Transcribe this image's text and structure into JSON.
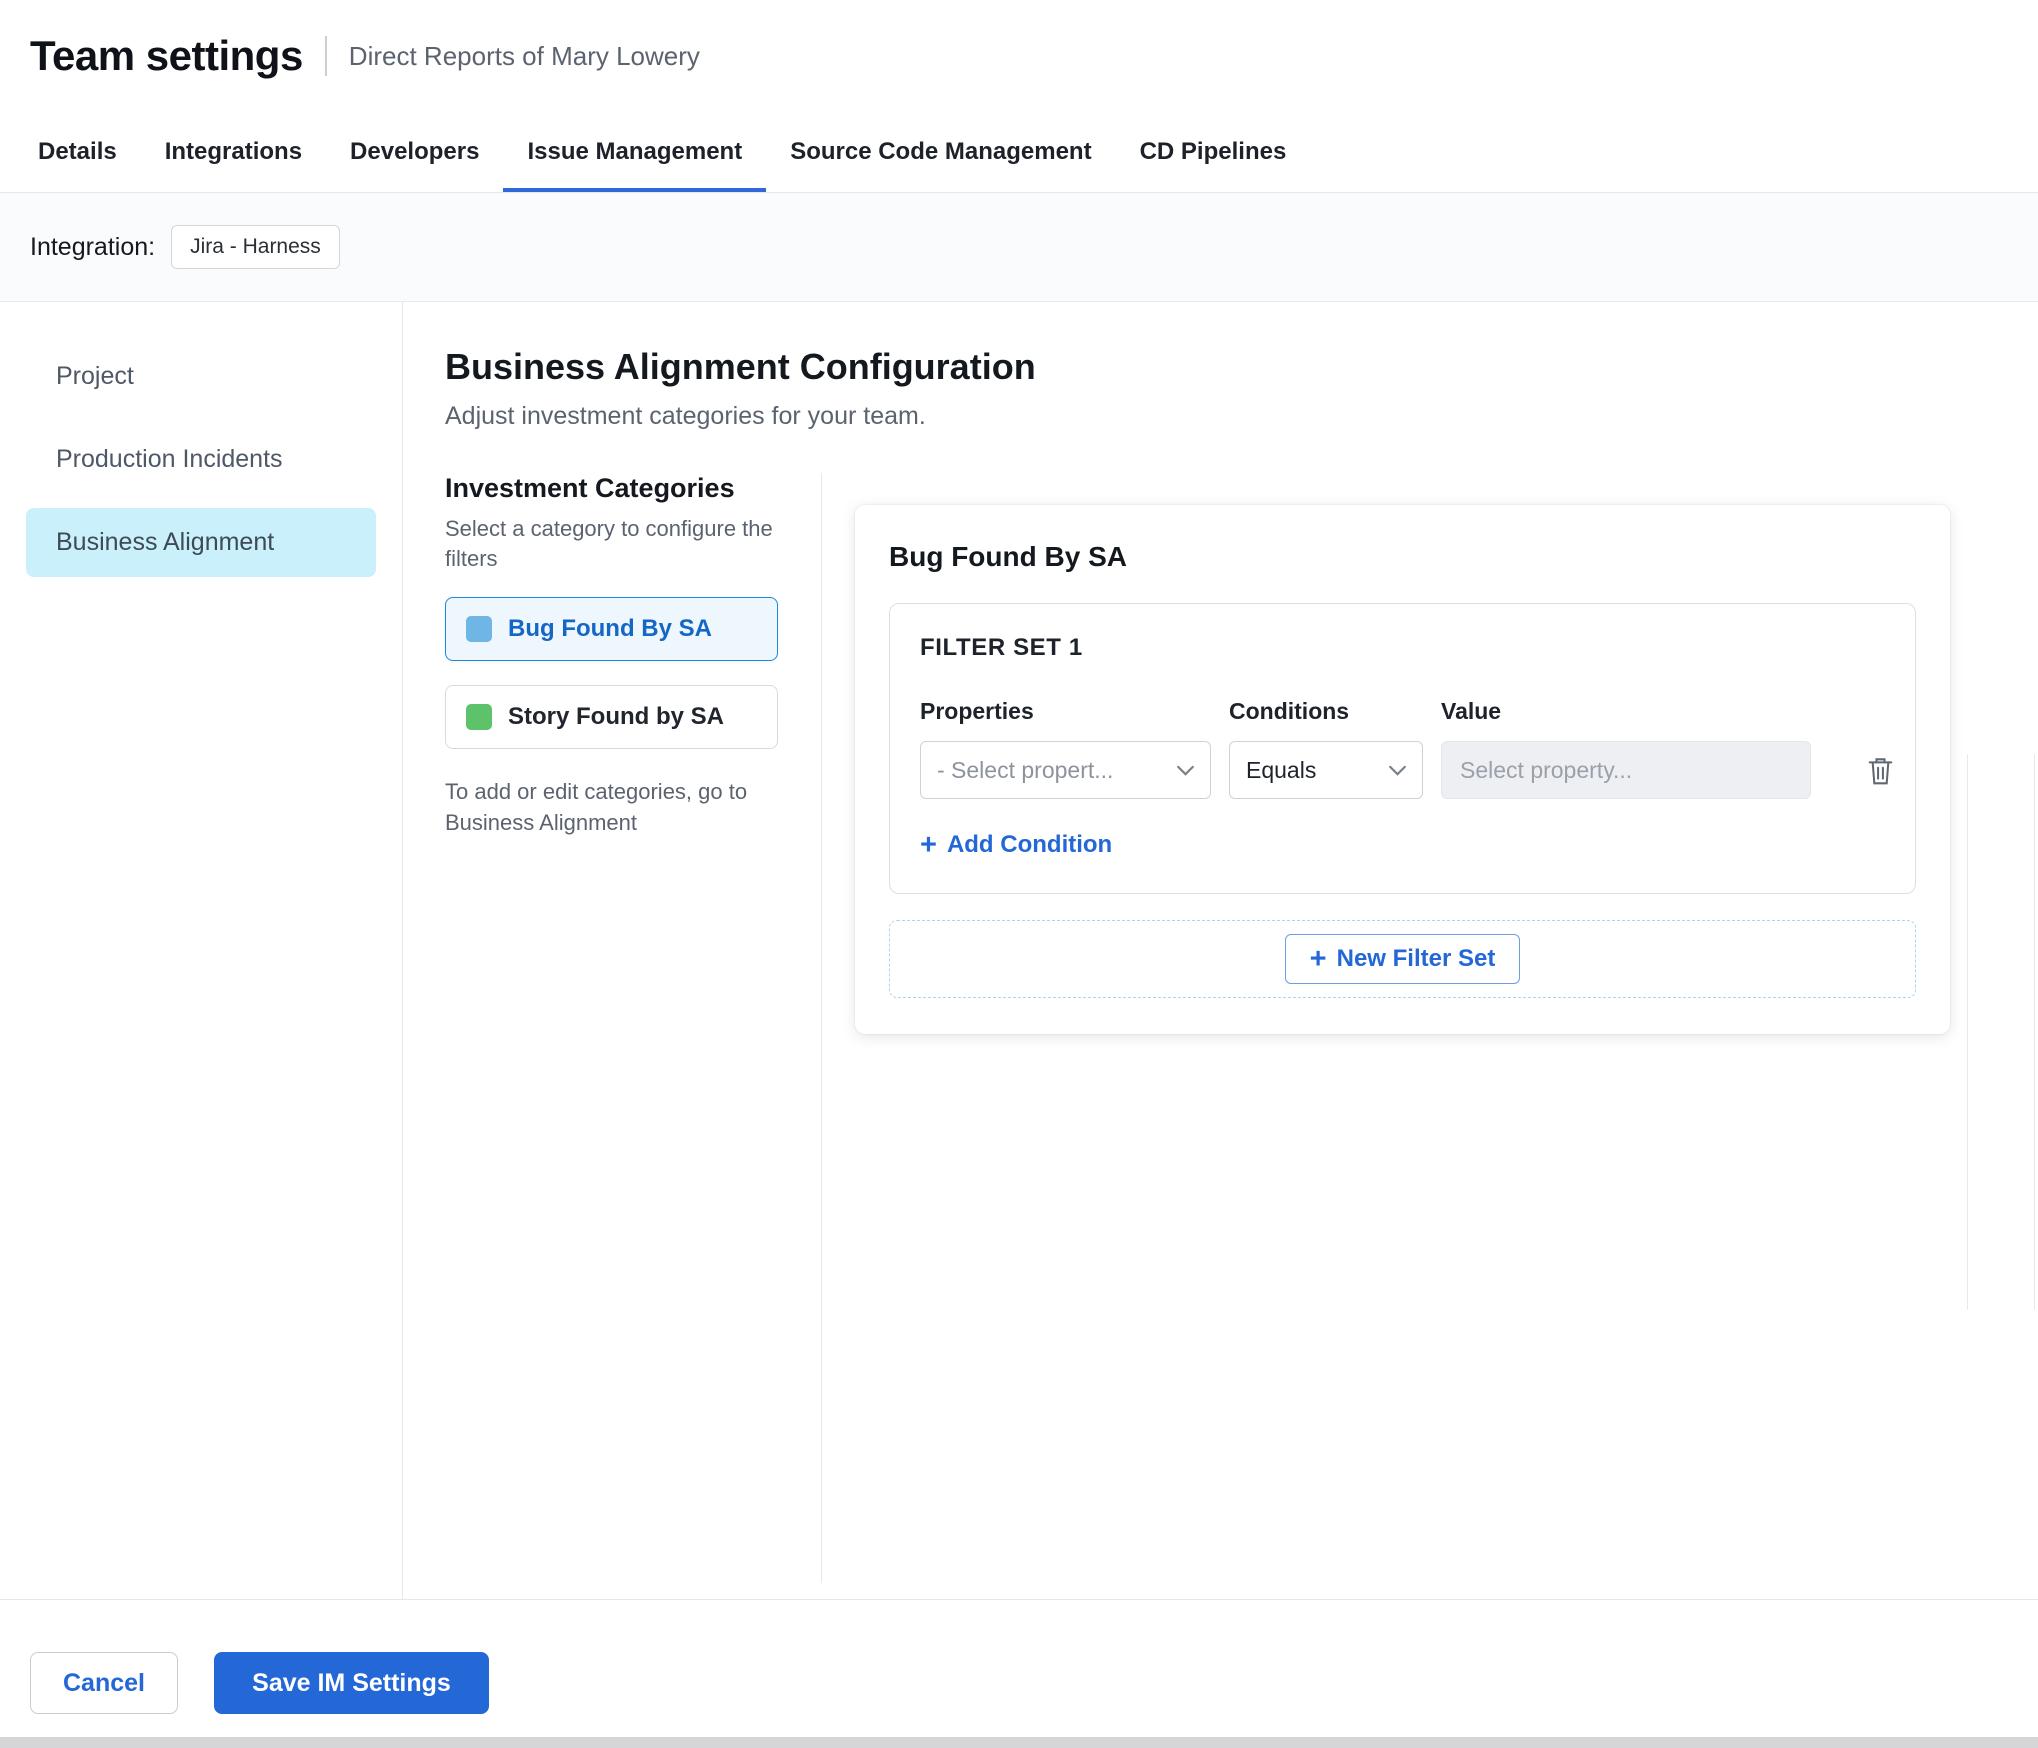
{
  "header": {
    "title": "Team settings",
    "subtitle": "Direct Reports of Mary Lowery"
  },
  "tabs": [
    {
      "label": "Details",
      "active": false
    },
    {
      "label": "Integrations",
      "active": false
    },
    {
      "label": "Developers",
      "active": false
    },
    {
      "label": "Issue Management",
      "active": true
    },
    {
      "label": "Source Code Management",
      "active": false
    },
    {
      "label": "CD Pipelines",
      "active": false
    }
  ],
  "integration_bar": {
    "label": "Integration:",
    "chip": "Jira - Harness"
  },
  "sidebar": {
    "items": [
      {
        "label": "Project",
        "active": false
      },
      {
        "label": "Production Incidents",
        "active": false
      },
      {
        "label": "Business Alignment",
        "active": true
      }
    ]
  },
  "content": {
    "title": "Business Alignment Configuration",
    "subtitle": "Adjust investment categories for your team.",
    "categories": {
      "heading": "Investment Categories",
      "description": "Select a category to configure the filters",
      "items": [
        {
          "label": "Bug Found By SA",
          "swatch_color": "#6fb5e6",
          "selected": true
        },
        {
          "label": "Story Found by SA",
          "swatch_color": "#5cc36a",
          "selected": false
        }
      ],
      "note": "To add or edit categories, go to Business Alignment"
    },
    "panel": {
      "title": "Bug Found By SA",
      "filter_set": {
        "heading": "FILTER SET 1",
        "properties_label": "Properties",
        "conditions_label": "Conditions",
        "value_label": "Value",
        "property_placeholder": "- Select propert...",
        "condition_selected": "Equals",
        "value_placeholder": "Select property...",
        "add_condition_label": "Add Condition"
      },
      "new_filter_set_label": "New Filter Set"
    }
  },
  "footer": {
    "cancel_label": "Cancel",
    "save_label": "Save IM Settings"
  },
  "icons": {
    "plus": "+"
  },
  "colors": {
    "primary_blue": "#2467d6",
    "tab_underline": "#3168d8",
    "sidebar_active_bg": "#c9f0fb",
    "category_selected_border": "#1f87da",
    "category_selected_bg": "#edf7fd",
    "bug_swatch": "#6fb5e6",
    "story_swatch": "#5cc36a"
  }
}
